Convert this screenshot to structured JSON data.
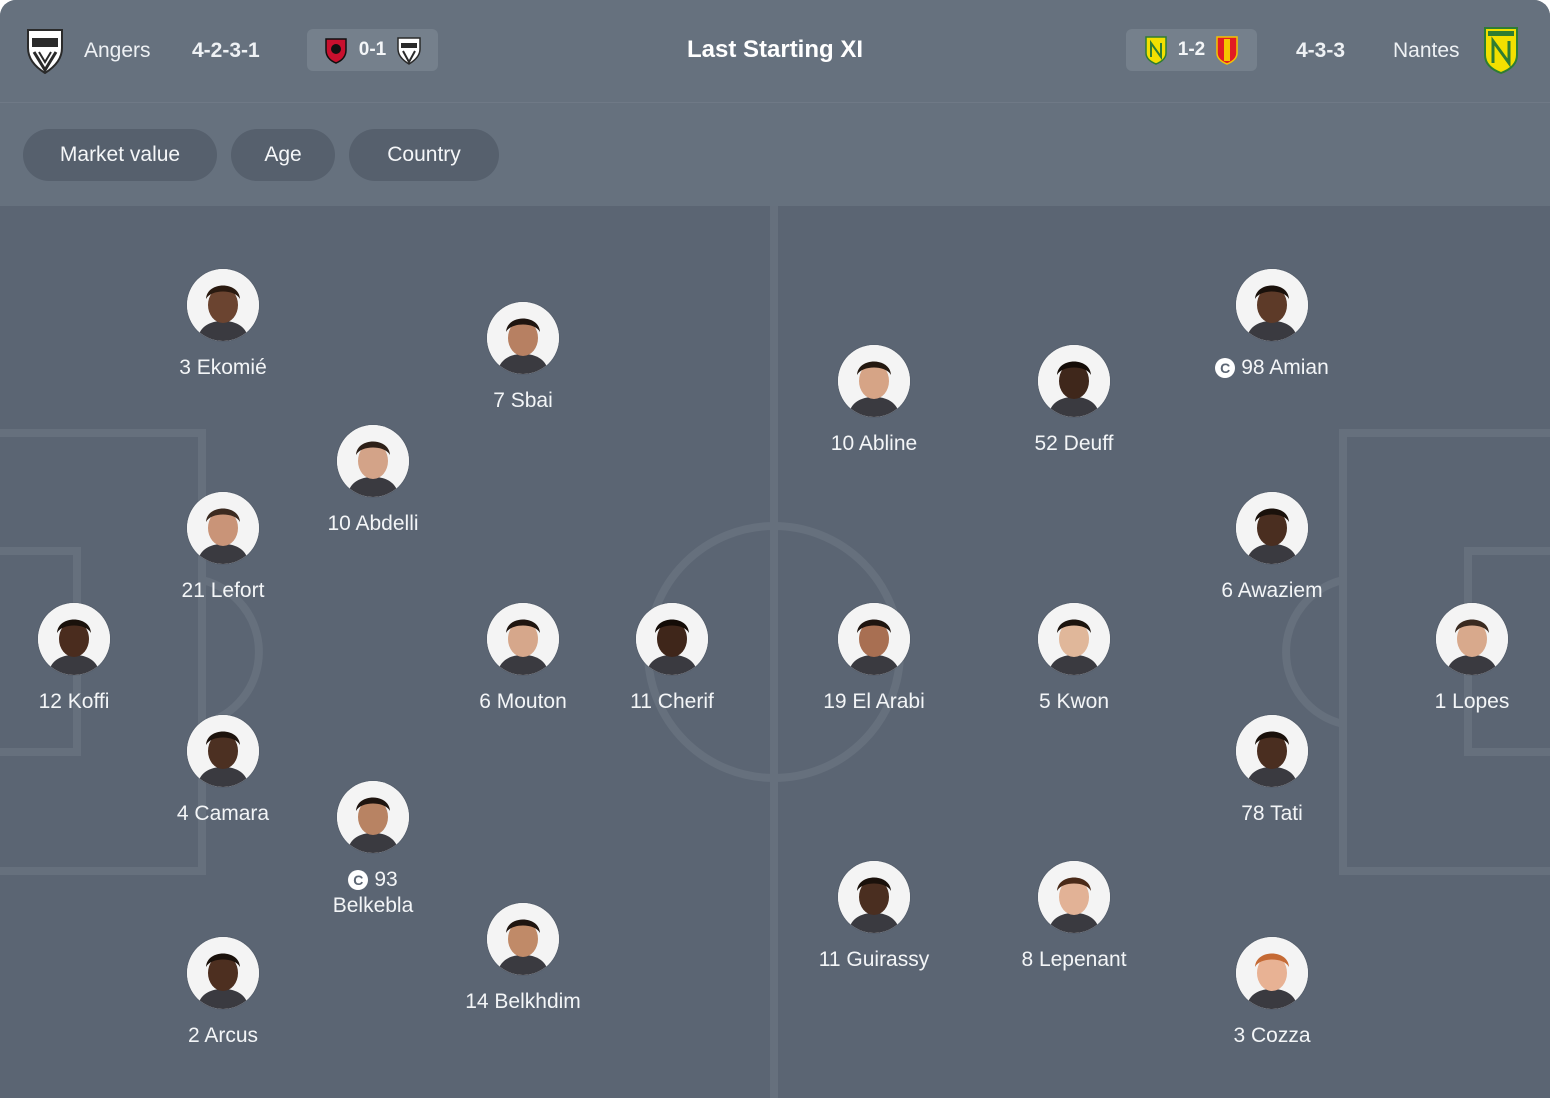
{
  "header": {
    "home_team": "Angers",
    "home_formation": "4-2-3-1",
    "home_last_score": "0-1",
    "title": "Last Starting XI",
    "away_last_score": "1-2",
    "away_formation": "4-3-3",
    "away_team": "Nantes"
  },
  "filters": [
    "Market value",
    "Age",
    "Country"
  ],
  "captain_mark": "C",
  "colors": {
    "pitch": "#5b6573",
    "header": "#66717e",
    "chip": "#56606d",
    "lines": "#66707d",
    "nantes_yellow": "#f2e000",
    "nice_red": "#c8102e",
    "lens_red": "#e21b23"
  },
  "home_players": [
    {
      "label": "3 Ekomié",
      "skin": "#6b4430",
      "hair": "#2a1a10"
    },
    {
      "label": "21 Lefort",
      "skin": "#c99478",
      "hair": "#3b2a20"
    },
    {
      "label": "12 Koffi",
      "skin": "#4a2c1e",
      "hair": "#1a110b"
    },
    {
      "label": "4 Camara",
      "skin": "#4c3022",
      "hair": "#1d130d"
    },
    {
      "label": "2 Arcus",
      "skin": "#4d2f20",
      "hair": "#1a110b"
    },
    {
      "label": "10 Abdelli",
      "skin": "#d3a388",
      "hair": "#2d2018"
    },
    {
      "number": "93",
      "name": "Belkebla",
      "captain": true,
      "skin": "#b88363",
      "hair": "#1f1510"
    },
    {
      "label": "7 Sbai",
      "skin": "#b78062",
      "hair": "#1f1510"
    },
    {
      "label": "6 Mouton",
      "skin": "#d6a78b",
      "hair": "#1f1510"
    },
    {
      "label": "14 Belkhdim",
      "skin": "#c08a68",
      "hair": "#1f1510"
    },
    {
      "label": "11 Cherif",
      "skin": "#3f261a",
      "hair": "#140c07"
    }
  ],
  "away_players": [
    {
      "label": "98 Amian",
      "captain": true,
      "skin": "#5d3a28",
      "hair": "#1a110b"
    },
    {
      "label": "6 Awaziem",
      "skin": "#4a2e20",
      "hair": "#1a110b"
    },
    {
      "label": "1 Lopes",
      "skin": "#d8a98c",
      "hair": "#3a2a20"
    },
    {
      "label": "78 Tati",
      "skin": "#4a2e20",
      "hair": "#1a110b"
    },
    {
      "label": "3 Cozza",
      "skin": "#e8b294",
      "hair": "#c56a35"
    },
    {
      "label": "10 Abline",
      "skin": "#d6a486",
      "hair": "#231810"
    },
    {
      "label": "52 Deuff",
      "skin": "#3f271b",
      "hair": "#140c07"
    },
    {
      "label": "19 El Arabi",
      "skin": "#a86f52",
      "hair": "#1f1510"
    },
    {
      "label": "5 Kwon",
      "skin": "#e0b79a",
      "hair": "#1c140e"
    },
    {
      "label": "11 Guirassy",
      "skin": "#4a2e20",
      "hair": "#1a110b"
    },
    {
      "label": "8 Lepenant",
      "skin": "#e2b296",
      "hair": "#4a2a18"
    }
  ]
}
